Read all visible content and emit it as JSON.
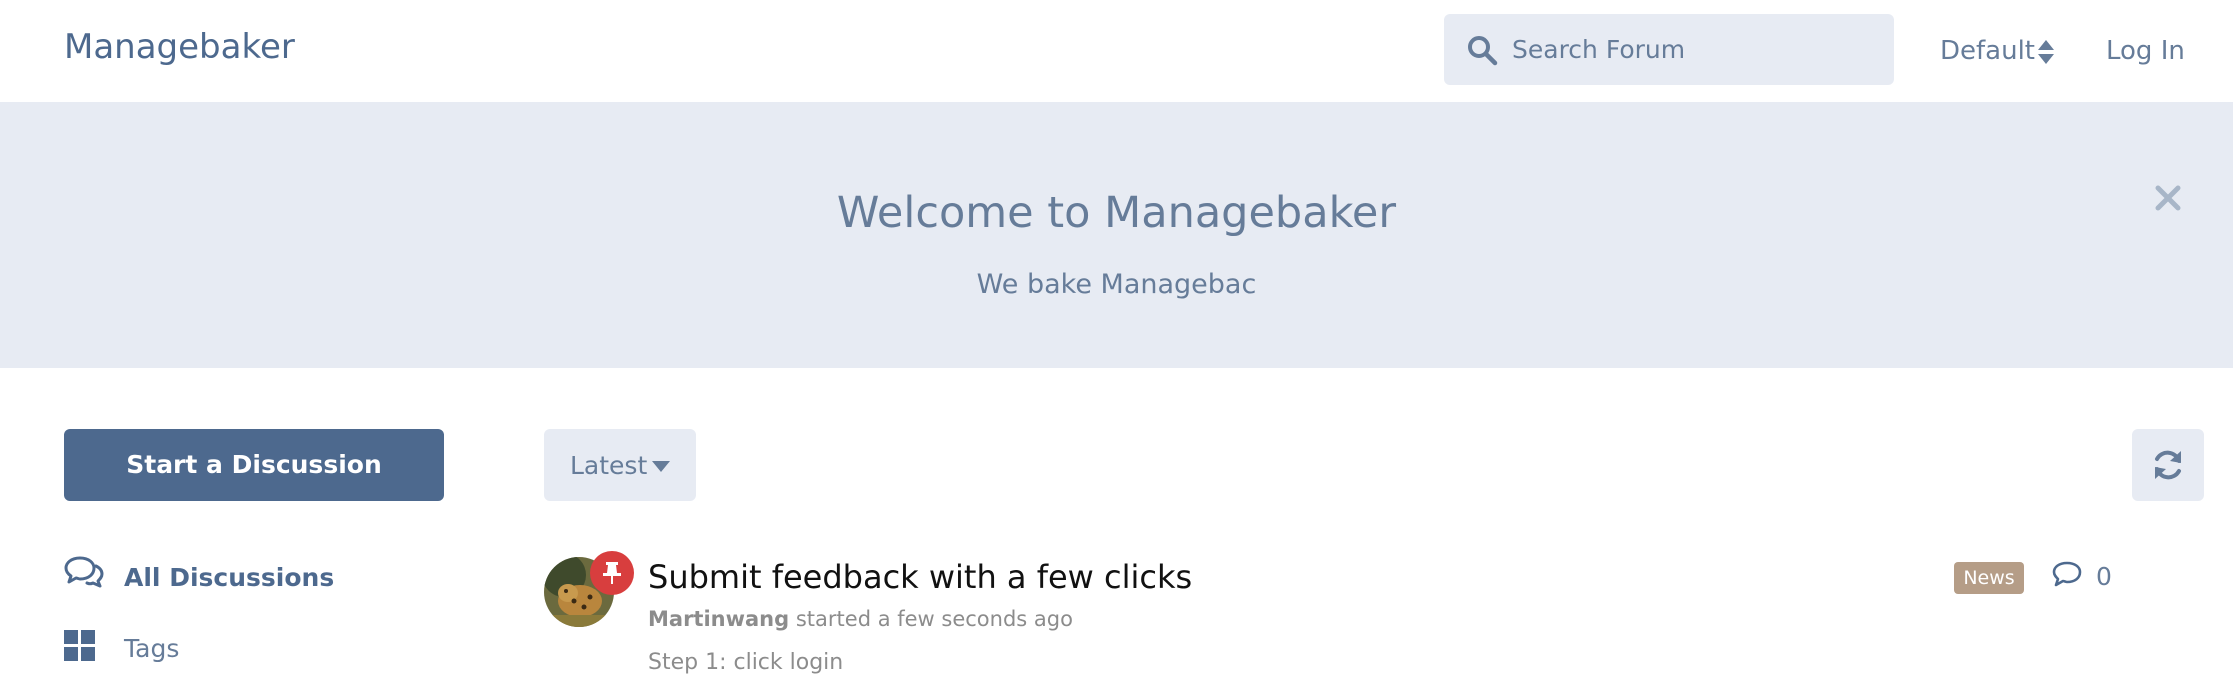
{
  "header": {
    "brand": "Managebaker",
    "search_placeholder": "Search Forum",
    "locale_label": "Default",
    "login_label": "Log In"
  },
  "hero": {
    "title": "Welcome to Managebaker",
    "subtitle": "We bake Managebac"
  },
  "sidebar": {
    "start_button": "Start a Discussion",
    "nav": [
      {
        "label": "All Discussions",
        "icon": "comments-icon",
        "active": true
      },
      {
        "label": "Tags",
        "icon": "grid-icon",
        "active": false
      }
    ]
  },
  "toolbar": {
    "sort_label": "Latest",
    "refresh_icon": "refresh-icon"
  },
  "discussions": [
    {
      "title": "Submit feedback with a few clicks",
      "author": "Martinwang",
      "started": "started a few seconds ago",
      "excerpt": "Step 1: click login",
      "tag": "News",
      "replies": "0",
      "pinned": true
    }
  ],
  "colors": {
    "primary": "#4d698e",
    "hero_bg": "#e7ebf3",
    "muted": "#667c99",
    "tag_news": "#b59d87",
    "pin": "#d83e3e"
  }
}
